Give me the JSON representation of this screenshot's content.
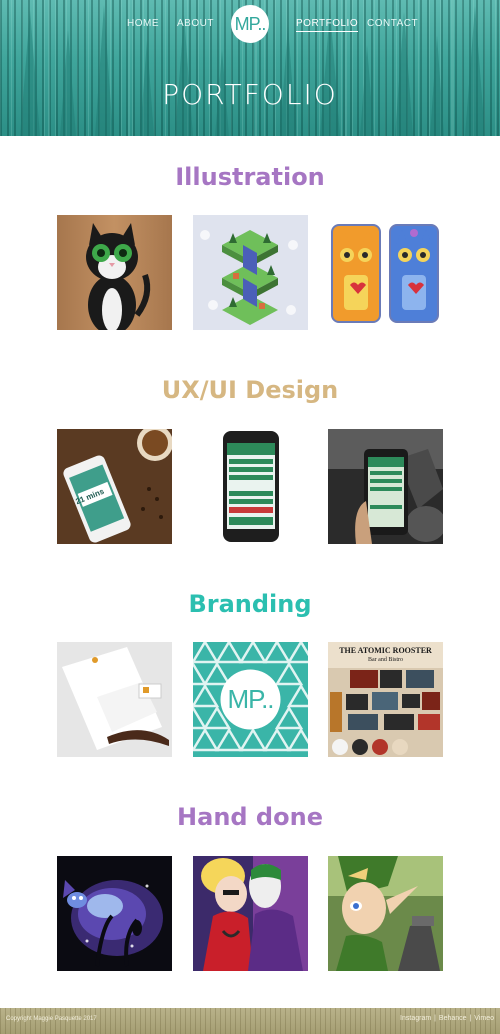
{
  "nav": {
    "home": "HOME",
    "about": "ABOUT",
    "logo": "MP..",
    "portfolio": "PORTFOLIO",
    "contact": "CONTACT"
  },
  "hero": {
    "title": "PORTFOLIO"
  },
  "sections": [
    {
      "title": "Illustration",
      "color": "#a676c3"
    },
    {
      "title": "UX/UI Design",
      "color": "#d6b782"
    },
    {
      "title": "Branding",
      "color": "#2bbfb0"
    },
    {
      "title": "Hand done",
      "color": "#a676c3"
    }
  ],
  "branding": {
    "rooster_title": "THE ATOMIC ROOSTER",
    "rooster_sub": "Bar and Bistro",
    "logo": "MP.."
  },
  "ux": {
    "phone_time": "21 mins"
  },
  "footer": {
    "copyright": "Copyright Maggie Pasquette 2017",
    "links": [
      "Instagram",
      "Behance",
      "Vimeo"
    ],
    "separator": "|"
  },
  "colors": {
    "teal": "#33a89d",
    "purple": "#a676c3",
    "tan": "#d6b782",
    "footer": "#a59e73"
  }
}
